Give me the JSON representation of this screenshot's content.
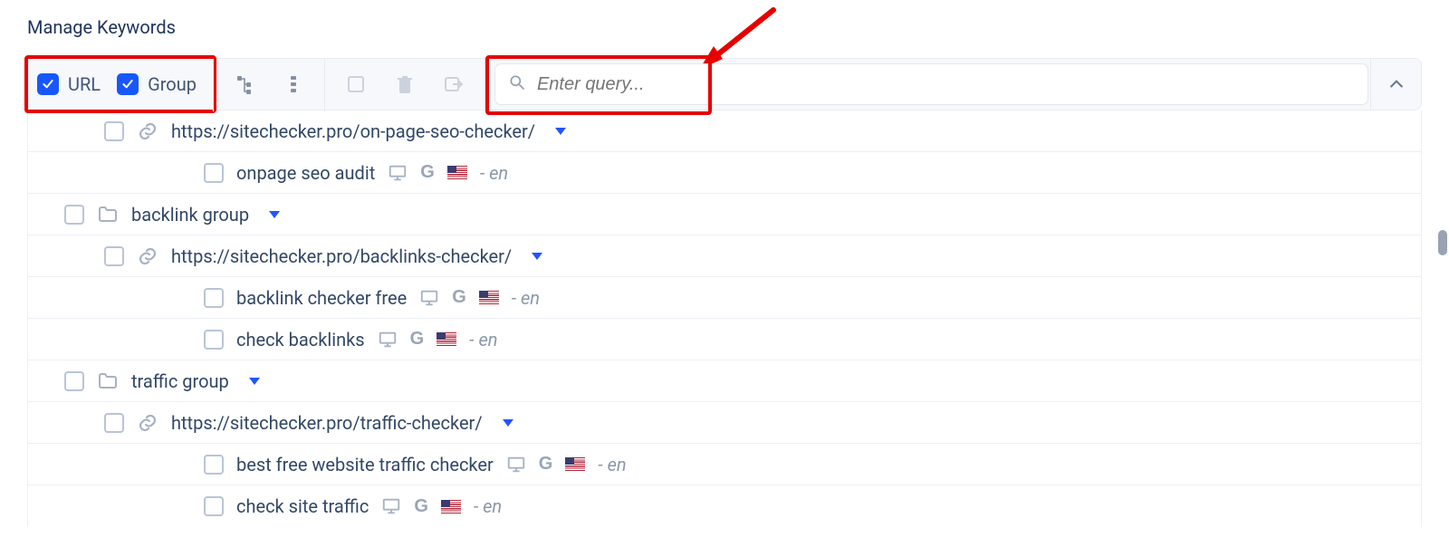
{
  "title": "Manage Keywords",
  "toolbar": {
    "url_label": "URL",
    "group_label": "Group",
    "search_placeholder": "Enter query..."
  },
  "lang_suffix": "- en",
  "groups": [
    {
      "urls": [
        {
          "href": "https://sitechecker.pro/on-page-seo-checker/",
          "keywords": [
            {
              "text": "onpage seo audit"
            }
          ]
        }
      ]
    },
    {
      "name": "backlink group",
      "urls": [
        {
          "href": "https://sitechecker.pro/backlinks-checker/",
          "keywords": [
            {
              "text": "backlink checker free"
            },
            {
              "text": "check backlinks"
            }
          ]
        }
      ]
    },
    {
      "name": "traffic group",
      "urls": [
        {
          "href": "https://sitechecker.pro/traffic-checker/",
          "keywords": [
            {
              "text": "best free website traffic checker"
            },
            {
              "text": "check site traffic"
            }
          ]
        }
      ]
    }
  ]
}
